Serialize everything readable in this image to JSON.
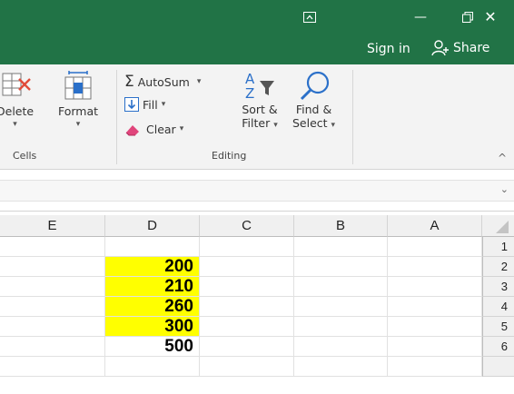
{
  "titlebar": {
    "ribbon_options_icon": "ribbon-display-options-icon",
    "minimize_glyph": "—",
    "restore_glyph": "🗗",
    "close_glyph": "✕",
    "bg_color": "#217346"
  },
  "account": {
    "sign_in_label": "Sign in",
    "share_label": "Share",
    "share_icon": "person-add-icon"
  },
  "ribbon": {
    "cells_group": {
      "label": "Cells",
      "delete_label": "Delete",
      "format_label": "Format"
    },
    "editing_group": {
      "label": "Editing",
      "autosum_label": "AutoSum",
      "autosum_glyph": "Σ",
      "fill_label": "Fill",
      "clear_label": "Clear",
      "sort_filter_label_1": "Sort &",
      "sort_filter_label_2": "Filter",
      "find_select_label_1": "Find &",
      "find_select_label_2": "Select",
      "caret": "▾"
    },
    "collapse_glyph": "^"
  },
  "formula_bar": {
    "expand_glyph": "⌄"
  },
  "grid": {
    "columns": [
      "E",
      "D",
      "C",
      "B",
      "A"
    ],
    "rows": [
      "1",
      "2",
      "3",
      "4",
      "5",
      "6"
    ],
    "column_d_values": [
      "",
      "200",
      "210",
      "260",
      "300",
      "500"
    ],
    "highlight_color": "#ffff00"
  }
}
